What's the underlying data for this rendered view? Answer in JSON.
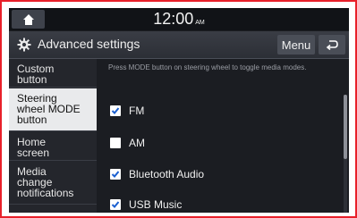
{
  "status": {
    "time": "12:00",
    "ampm": "AM"
  },
  "title": {
    "text": "Advanced settings",
    "menu_label": "Menu"
  },
  "sidebar": {
    "items": [
      {
        "lines": [
          "Custom",
          "button"
        ],
        "active": false
      },
      {
        "lines": [
          "Steering",
          "wheel MODE",
          "button"
        ],
        "active": true
      },
      {
        "lines": [
          "Home",
          "screen"
        ],
        "active": false
      },
      {
        "lines": [
          "Media",
          "change",
          "notifications"
        ],
        "active": false
      }
    ]
  },
  "content": {
    "hint": "Press MODE button on steering wheel to toggle media modes.",
    "options": [
      {
        "label": "FM",
        "checked": true
      },
      {
        "label": "AM",
        "checked": false
      },
      {
        "label": "Bluetooth Audio",
        "checked": true
      },
      {
        "label": "USB Music",
        "checked": true
      }
    ]
  },
  "colors": {
    "frame_border": "#e8202a",
    "screen_bg": "#1b1d22",
    "active_item_bg": "#e9eaec",
    "checkmark": "#1a5fd0"
  },
  "icons": {
    "home": "home-icon",
    "settings": "gear-icon",
    "back": "back-arrow-icon",
    "check": "checkmark-icon"
  }
}
